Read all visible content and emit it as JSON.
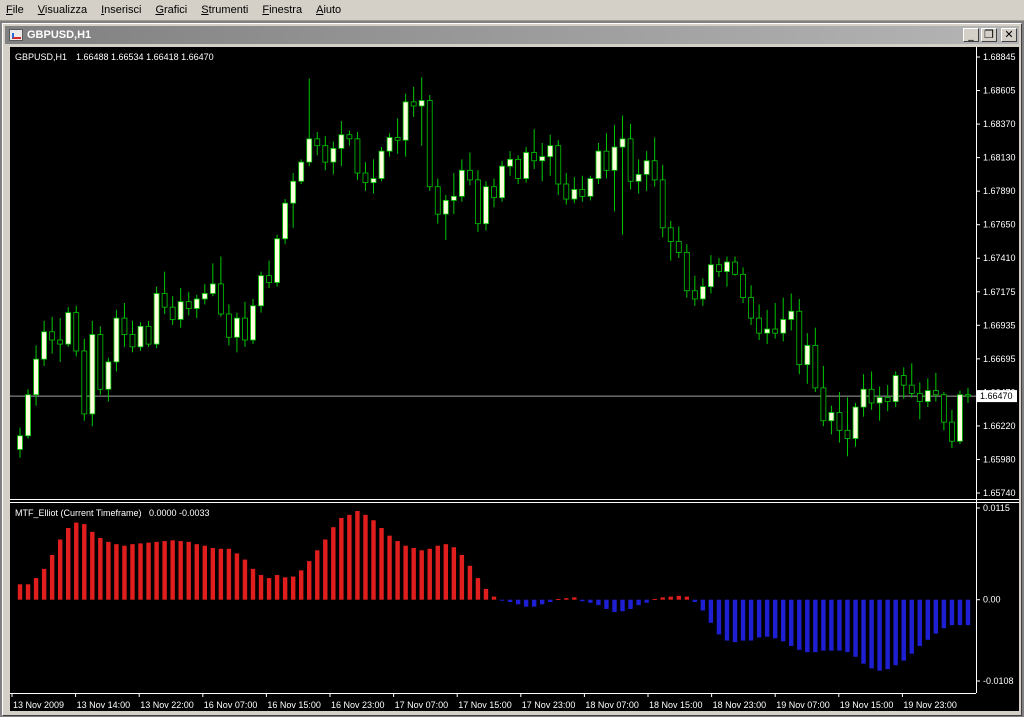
{
  "menu": [
    "File",
    "Visualizza",
    "Inserisci",
    "Grafici",
    "Strumenti",
    "Finestra",
    "Aiuto"
  ],
  "window": {
    "title": "GBPUSD,H1",
    "buttons": {
      "minimize": "_",
      "restore": "❐",
      "close": "✕"
    }
  },
  "colors": {
    "bull_body": "#ffffe0",
    "wick": "#00c800",
    "bear_body": "#000000",
    "indicator_positive": "#e11e1e",
    "indicator_negative": "#1e1ed2",
    "price_line": "#a0a0a0",
    "axis": "#ffffff"
  },
  "chart_data": [
    {
      "type": "candlestick",
      "title": "GBPUSD,H1",
      "ohlc_label": "1.66488 1.66534 1.66418 1.66470",
      "current_price": "1.66470",
      "ylim": [
        1.6574,
        1.6897
      ],
      "ytick_labels": [
        "1.68845",
        "1.68605",
        "1.68370",
        "1.68130",
        "1.67890",
        "1.67650",
        "1.67410",
        "1.67175",
        "1.66935",
        "1.66695",
        "1.66470",
        "1.66220",
        "1.65980",
        "1.65740"
      ],
      "ohlc": [
        [
          1.6608,
          1.6624,
          1.6602,
          1.6618
        ],
        [
          1.6618,
          1.6652,
          1.6616,
          1.6648
        ],
        [
          1.6648,
          1.6684,
          1.664,
          1.6674
        ],
        [
          1.6674,
          1.6702,
          1.6669,
          1.6694
        ],
        [
          1.6694,
          1.6705,
          1.6678,
          1.6688
        ],
        [
          1.6688,
          1.6704,
          1.6672,
          1.6685
        ],
        [
          1.6685,
          1.6712,
          1.6683,
          1.6708
        ],
        [
          1.6708,
          1.6713,
          1.6676,
          1.668
        ],
        [
          1.668,
          1.6689,
          1.6629,
          1.6634
        ],
        [
          1.6634,
          1.6702,
          1.6625,
          1.6692
        ],
        [
          1.6692,
          1.6698,
          1.6648,
          1.6652
        ],
        [
          1.6652,
          1.6675,
          1.6643,
          1.6672
        ],
        [
          1.6672,
          1.671,
          1.6665,
          1.6704
        ],
        [
          1.6704,
          1.6715,
          1.6683,
          1.6692
        ],
        [
          1.6692,
          1.6702,
          1.6679,
          1.6683
        ],
        [
          1.6683,
          1.6701,
          1.668,
          1.6698
        ],
        [
          1.6698,
          1.6702,
          1.6683,
          1.6685
        ],
        [
          1.6685,
          1.6727,
          1.6682,
          1.6722
        ],
        [
          1.6722,
          1.6738,
          1.6707,
          1.6712
        ],
        [
          1.6712,
          1.672,
          1.6699,
          1.6703
        ],
        [
          1.6703,
          1.6726,
          1.6697,
          1.6716
        ],
        [
          1.6716,
          1.6723,
          1.6706,
          1.6711
        ],
        [
          1.6711,
          1.6721,
          1.6704,
          1.6718
        ],
        [
          1.6718,
          1.6729,
          1.6714,
          1.6722
        ],
        [
          1.6722,
          1.6744,
          1.672,
          1.6729
        ],
        [
          1.6729,
          1.6749,
          1.6705,
          1.6707
        ],
        [
          1.6707,
          1.6714,
          1.6684,
          1.669
        ],
        [
          1.669,
          1.6708,
          1.6679,
          1.6704
        ],
        [
          1.6704,
          1.6716,
          1.6683,
          1.6688
        ],
        [
          1.6688,
          1.6718,
          1.6685,
          1.6713
        ],
        [
          1.6713,
          1.6738,
          1.6708,
          1.6735
        ],
        [
          1.6735,
          1.6746,
          1.6726,
          1.673
        ],
        [
          1.673,
          1.6765,
          1.6727,
          1.6762
        ],
        [
          1.6762,
          1.6791,
          1.6758,
          1.6788
        ],
        [
          1.6788,
          1.681,
          1.677,
          1.6804
        ],
        [
          1.6804,
          1.682,
          1.6802,
          1.6818
        ],
        [
          1.6818,
          1.6879,
          1.6815,
          1.6835
        ],
        [
          1.6835,
          1.684,
          1.6823,
          1.683
        ],
        [
          1.683,
          1.6837,
          1.6812,
          1.6818
        ],
        [
          1.6818,
          1.6833,
          1.6809,
          1.6828
        ],
        [
          1.6828,
          1.6848,
          1.6815,
          1.6838
        ],
        [
          1.6838,
          1.6841,
          1.683,
          1.6835
        ],
        [
          1.6835,
          1.684,
          1.6805,
          1.681
        ],
        [
          1.681,
          1.6818,
          1.6797,
          1.6803
        ],
        [
          1.6803,
          1.682,
          1.6795,
          1.6806
        ],
        [
          1.6806,
          1.6829,
          1.6804,
          1.6826
        ],
        [
          1.6826,
          1.6839,
          1.6822,
          1.6836
        ],
        [
          1.6836,
          1.685,
          1.6824,
          1.6834
        ],
        [
          1.6834,
          1.6868,
          1.6822,
          1.6862
        ],
        [
          1.6862,
          1.6873,
          1.6851,
          1.6859
        ],
        [
          1.6859,
          1.688,
          1.683,
          1.6863
        ],
        [
          1.6863,
          1.6867,
          1.6797,
          1.68
        ],
        [
          1.68,
          1.6806,
          1.6773,
          1.678
        ],
        [
          1.678,
          1.6794,
          1.6761,
          1.679
        ],
        [
          1.679,
          1.681,
          1.678,
          1.6793
        ],
        [
          1.6793,
          1.682,
          1.6789,
          1.6812
        ],
        [
          1.6812,
          1.6825,
          1.6801,
          1.6805
        ],
        [
          1.6805,
          1.6812,
          1.6767,
          1.6773
        ],
        [
          1.6773,
          1.6804,
          1.6768,
          1.68
        ],
        [
          1.68,
          1.6806,
          1.6785,
          1.6792
        ],
        [
          1.6792,
          1.6819,
          1.6789,
          1.6815
        ],
        [
          1.6815,
          1.6826,
          1.6808,
          1.682
        ],
        [
          1.682,
          1.6823,
          1.6802,
          1.6806
        ],
        [
          1.6806,
          1.6829,
          1.6803,
          1.6825
        ],
        [
          1.6825,
          1.6842,
          1.6813,
          1.6819
        ],
        [
          1.6819,
          1.6832,
          1.6804,
          1.6822
        ],
        [
          1.6822,
          1.6838,
          1.6808,
          1.683
        ],
        [
          1.683,
          1.6834,
          1.6794,
          1.6802
        ],
        [
          1.6802,
          1.681,
          1.6787,
          1.6791
        ],
        [
          1.6791,
          1.6807,
          1.6788,
          1.6798
        ],
        [
          1.6798,
          1.6808,
          1.6789,
          1.6793
        ],
        [
          1.6793,
          1.6808,
          1.679,
          1.6806
        ],
        [
          1.6806,
          1.6832,
          1.6802,
          1.6826
        ],
        [
          1.6826,
          1.6839,
          1.6806,
          1.6812
        ],
        [
          1.6812,
          1.6845,
          1.6782,
          1.6829
        ],
        [
          1.6829,
          1.6852,
          1.6765,
          1.6835
        ],
        [
          1.6835,
          1.6846,
          1.6798,
          1.6804
        ],
        [
          1.6804,
          1.682,
          1.6795,
          1.6809
        ],
        [
          1.6809,
          1.6826,
          1.6797,
          1.6819
        ],
        [
          1.6819,
          1.6836,
          1.68,
          1.6805
        ],
        [
          1.6805,
          1.6816,
          1.6763,
          1.677
        ],
        [
          1.677,
          1.6775,
          1.6746,
          1.676
        ],
        [
          1.676,
          1.6771,
          1.6748,
          1.6752
        ],
        [
          1.6752,
          1.6758,
          1.6719,
          1.6724
        ],
        [
          1.6724,
          1.6735,
          1.6713,
          1.6718
        ],
        [
          1.6718,
          1.6733,
          1.6713,
          1.6727
        ],
        [
          1.6727,
          1.675,
          1.6722,
          1.6743
        ],
        [
          1.6743,
          1.6748,
          1.6734,
          1.6738
        ],
        [
          1.6738,
          1.6749,
          1.6727,
          1.6745
        ],
        [
          1.6745,
          1.6749,
          1.6735,
          1.6736
        ],
        [
          1.6736,
          1.6741,
          1.6715,
          1.6719
        ],
        [
          1.6719,
          1.6728,
          1.6699,
          1.6704
        ],
        [
          1.6704,
          1.6714,
          1.6688,
          1.6693
        ],
        [
          1.6693,
          1.671,
          1.6685,
          1.6696
        ],
        [
          1.6696,
          1.6715,
          1.6689,
          1.6693
        ],
        [
          1.6693,
          1.6719,
          1.6687,
          1.6703
        ],
        [
          1.6703,
          1.6722,
          1.6695,
          1.6709
        ],
        [
          1.6709,
          1.6718,
          1.6663,
          1.667
        ],
        [
          1.667,
          1.6693,
          1.6656,
          1.6684
        ],
        [
          1.6684,
          1.6697,
          1.665,
          1.6653
        ],
        [
          1.6653,
          1.6669,
          1.6625,
          1.6629
        ],
        [
          1.6629,
          1.664,
          1.6619,
          1.6635
        ],
        [
          1.6635,
          1.665,
          1.6613,
          1.6622
        ],
        [
          1.6622,
          1.6646,
          1.6603,
          1.6616
        ],
        [
          1.6616,
          1.6642,
          1.661,
          1.6639
        ],
        [
          1.6639,
          1.6663,
          1.6632,
          1.6652
        ],
        [
          1.6652,
          1.6665,
          1.6637,
          1.6642
        ],
        [
          1.6642,
          1.6654,
          1.6629,
          1.6646
        ],
        [
          1.6646,
          1.6655,
          1.6636,
          1.6643
        ],
        [
          1.6643,
          1.6665,
          1.6639,
          1.6662
        ],
        [
          1.6662,
          1.6668,
          1.6645,
          1.6655
        ],
        [
          1.6655,
          1.6671,
          1.6646,
          1.6649
        ],
        [
          1.6649,
          1.6657,
          1.663,
          1.6643
        ],
        [
          1.6643,
          1.666,
          1.6639,
          1.6651
        ],
        [
          1.6651,
          1.6664,
          1.6643,
          1.6648
        ],
        [
          1.6648,
          1.665,
          1.6622,
          1.6628
        ],
        [
          1.6628,
          1.6637,
          1.6609,
          1.6614
        ],
        [
          1.6614,
          1.6651,
          1.6612,
          1.6648
        ],
        [
          1.6648,
          1.6653,
          1.6642,
          1.6647
        ]
      ]
    },
    {
      "type": "bar",
      "title": "MTF_Elliot (Current Timeframe)",
      "legend_values": "0.0000 -0.0033",
      "ylim": [
        -0.0108,
        0.0115
      ],
      "ytick_labels": [
        "0.0115",
        "0.00",
        "-0.0108"
      ],
      "values": [
        0.002,
        0.002,
        0.0028,
        0.004,
        0.0058,
        0.0078,
        0.0093,
        0.01,
        0.0098,
        0.0088,
        0.008,
        0.0075,
        0.0072,
        0.007,
        0.0072,
        0.0073,
        0.0074,
        0.0075,
        0.0076,
        0.0077,
        0.0076,
        0.0075,
        0.0072,
        0.007,
        0.0067,
        0.0066,
        0.0066,
        0.006,
        0.0052,
        0.004,
        0.0032,
        0.0028,
        0.0032,
        0.0029,
        0.003,
        0.0038,
        0.005,
        0.0064,
        0.0078,
        0.0094,
        0.0106,
        0.011,
        0.0115,
        0.011,
        0.0103,
        0.0093,
        0.0083,
        0.0076,
        0.007,
        0.0067,
        0.0064,
        0.0066,
        0.007,
        0.0072,
        0.0068,
        0.0058,
        0.0044,
        0.0028,
        0.0014,
        0.0004,
        -0.0001,
        -0.0003,
        -0.0006,
        -0.0009,
        -0.0009,
        -0.0006,
        -0.0003,
        0.0001,
        0.0002,
        0.0003,
        -0.0002,
        -0.0004,
        -0.0007,
        -0.0012,
        -0.0016,
        -0.0015,
        -0.0012,
        -0.0007,
        -0.0004,
        0.0001,
        0.0003,
        0.0004,
        0.0005,
        0.0004,
        -0.0003,
        -0.0014,
        -0.003,
        -0.0045,
        -0.0053,
        -0.0055,
        -0.0053,
        -0.0053,
        -0.0049,
        -0.0048,
        -0.005,
        -0.0054,
        -0.006,
        -0.0065,
        -0.0068,
        -0.0068,
        -0.0066,
        -0.0066,
        -0.0066,
        -0.0068,
        -0.0074,
        -0.0083,
        -0.0089,
        -0.0092,
        -0.009,
        -0.0085,
        -0.0079,
        -0.007,
        -0.006,
        -0.0052,
        -0.0044,
        -0.0037,
        -0.0033,
        -0.0033,
        -0.0033
      ],
      "x_tick_labels": [
        "13 Nov 2009",
        "13 Nov 14:00",
        "13 Nov 22:00",
        "16 Nov 07:00",
        "16 Nov 15:00",
        "16 Nov 23:00",
        "17 Nov 07:00",
        "17 Nov 15:00",
        "17 Nov 23:00",
        "18 Nov 07:00",
        "18 Nov 15:00",
        "18 Nov 23:00",
        "19 Nov 07:00",
        "19 Nov 15:00",
        "19 Nov 23:00"
      ]
    }
  ]
}
